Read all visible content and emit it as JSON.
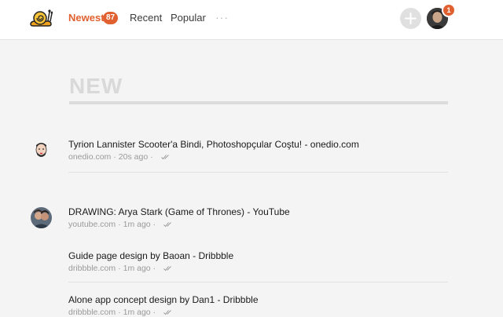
{
  "nav": {
    "tabs": [
      {
        "label": "Newest",
        "active": true
      },
      {
        "label": "Recent",
        "active": false
      },
      {
        "label": "Popular",
        "active": false
      }
    ],
    "newest_count": "87",
    "more_label": "···"
  },
  "user": {
    "notifications": "1"
  },
  "section": {
    "title": "NEW"
  },
  "items": [
    {
      "title": "Tyrion Lannister Scooter'a Bindi, Photoshopçular Coştu! - onedio.com",
      "domain": "onedio.com",
      "time": "20s ago"
    },
    {
      "title": "DRAWING: Arya Stark (Game of Thrones) - YouTube",
      "domain": "youtube.com",
      "time": "1m ago"
    },
    {
      "title": "Guide page design by Baoan - Dribbble",
      "domain": "dribbble.com",
      "time": "1m ago"
    },
    {
      "title": "Alone app concept design by Dan1 - Dribbble",
      "domain": "dribbble.com",
      "time": "1m ago"
    }
  ],
  "colors": {
    "accent": "#e0612f",
    "background": "#f4f4f4"
  },
  "icons": {
    "logo": "snail-icon",
    "add": "plus-icon",
    "read": "double-check-icon"
  }
}
